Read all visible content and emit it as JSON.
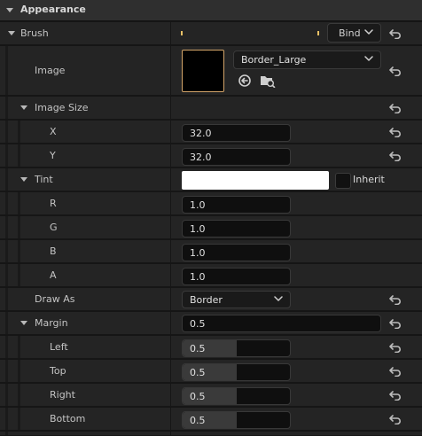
{
  "section": {
    "title": "Appearance"
  },
  "brush": {
    "label": "Brush",
    "bind_label": "Bind"
  },
  "image": {
    "label": "Image",
    "asset": "Border_Large"
  },
  "image_size": {
    "label": "Image Size",
    "x_label": "X",
    "x_value": "32.0",
    "y_label": "Y",
    "y_value": "32.0"
  },
  "tint": {
    "label": "Tint",
    "inherit_label": "Inherit",
    "swatch_color": "#ffffff",
    "channels": [
      {
        "label": "R",
        "value": "1.0"
      },
      {
        "label": "G",
        "value": "1.0"
      },
      {
        "label": "B",
        "value": "1.0"
      },
      {
        "label": "A",
        "value": "1.0"
      }
    ]
  },
  "draw_as": {
    "label": "Draw As",
    "value": "Border"
  },
  "margin": {
    "label": "Margin",
    "value": "0.5",
    "sides": [
      {
        "label": "Left",
        "value": "0.5",
        "fill_fraction": 0.5
      },
      {
        "label": "Top",
        "value": "0.5",
        "fill_fraction": 0.5
      },
      {
        "label": "Right",
        "value": "0.5",
        "fill_fraction": 0.5
      },
      {
        "label": "Bottom",
        "value": "0.5",
        "fill_fraction": 0.5
      }
    ]
  },
  "colors": {
    "accent_tick": "#e8c066",
    "thumbnail_border": "#d4a56a"
  }
}
